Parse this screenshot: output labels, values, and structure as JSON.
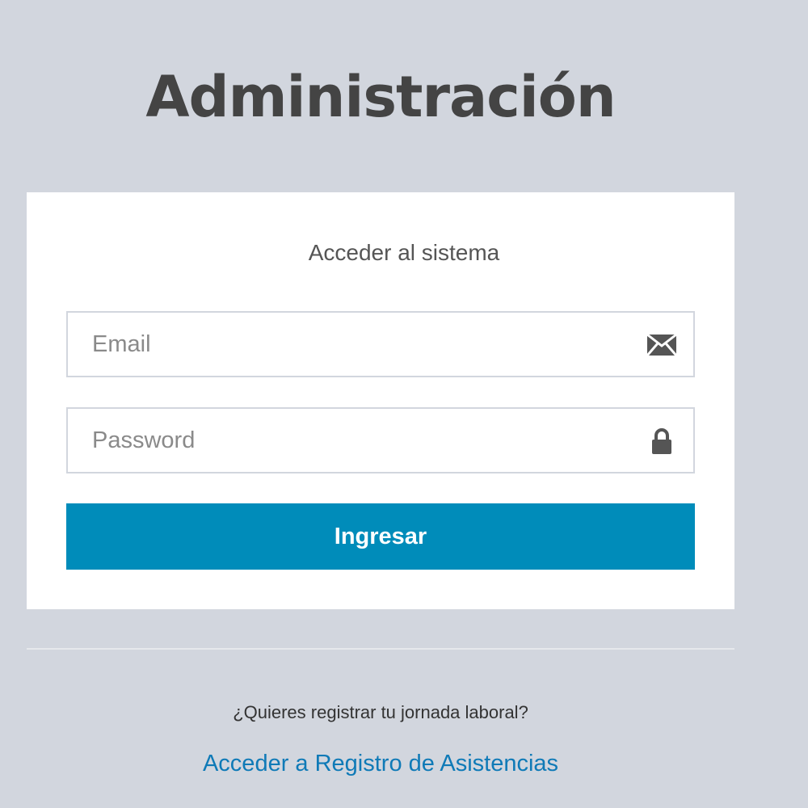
{
  "header": {
    "title": "Administración"
  },
  "login": {
    "message": "Acceder al sistema",
    "email": {
      "placeholder": "Email",
      "value": "",
      "icon": "envelope-icon"
    },
    "password": {
      "placeholder": "Password",
      "value": "",
      "icon": "lock-icon"
    },
    "submit_label": "Ingresar"
  },
  "footer": {
    "question": "¿Quieres registrar tu jornada laboral?",
    "link_label": "Acceder a Registro de Asistencias"
  },
  "colors": {
    "background": "#d2d6de",
    "card": "#ffffff",
    "primary_button": "#008cba",
    "link": "#0f7ab7",
    "title": "#444444",
    "icon": "#555555"
  }
}
